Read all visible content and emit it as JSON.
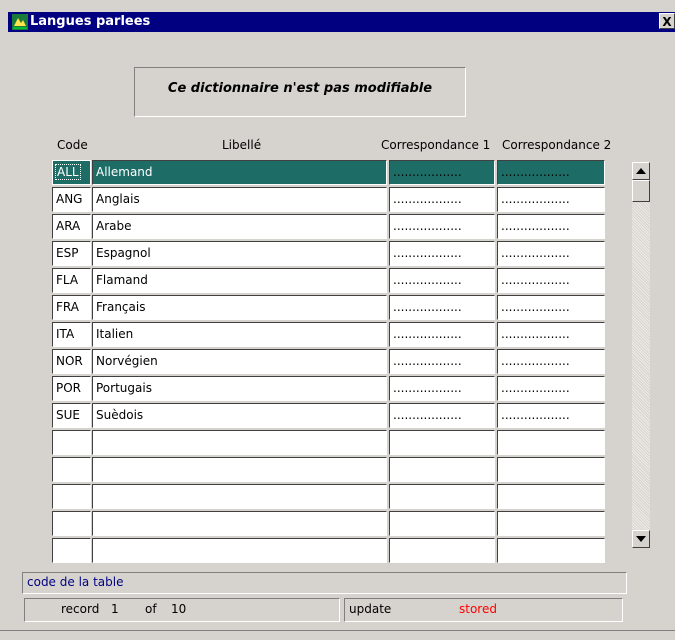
{
  "window": {
    "title": "Langues parlees",
    "close_label": "X"
  },
  "notice": "Ce dictionnaire n'est pas modifiable",
  "columns": {
    "code": "Code",
    "libelle": "Libellé",
    "corr1": "Correspondance 1",
    "corr2": "Correspondance 2"
  },
  "rows": [
    {
      "code": "ALL",
      "libelle": "Allemand",
      "corr1": "..................",
      "corr2": ".................."
    },
    {
      "code": "ANG",
      "libelle": "Anglais",
      "corr1": "..................",
      "corr2": ".................."
    },
    {
      "code": "ARA",
      "libelle": "Arabe",
      "corr1": "..................",
      "corr2": ".................."
    },
    {
      "code": "ESP",
      "libelle": "Espagnol",
      "corr1": "..................",
      "corr2": ".................."
    },
    {
      "code": "FLA",
      "libelle": "Flamand",
      "corr1": "..................",
      "corr2": ".................."
    },
    {
      "code": "FRA",
      "libelle": "Français",
      "corr1": "..................",
      "corr2": ".................."
    },
    {
      "code": "ITA",
      "libelle": "Italien",
      "corr1": "..................",
      "corr2": ".................."
    },
    {
      "code": "NOR",
      "libelle": "Norvégien",
      "corr1": "..................",
      "corr2": ".................."
    },
    {
      "code": "POR",
      "libelle": "Portugais",
      "corr1": "..................",
      "corr2": ".................."
    },
    {
      "code": "SUE",
      "libelle": "Suèdois",
      "corr1": "..................",
      "corr2": ".................."
    },
    {
      "code": "",
      "libelle": "",
      "corr1": "",
      "corr2": ""
    },
    {
      "code": "",
      "libelle": "",
      "corr1": "",
      "corr2": ""
    },
    {
      "code": "",
      "libelle": "",
      "corr1": "",
      "corr2": ""
    },
    {
      "code": "",
      "libelle": "",
      "corr1": "",
      "corr2": ""
    },
    {
      "code": "",
      "libelle": "",
      "corr1": "",
      "corr2": ""
    }
  ],
  "hint": "code de la table",
  "status": {
    "record_label": "record",
    "record_index": "1",
    "of_label": "of",
    "record_total": "10",
    "mode": "update",
    "state": "stored"
  },
  "colors": {
    "title_bar": "#000080",
    "selected_row": "#1d6d66",
    "hint_text": "#000080",
    "state_text": "#ff0000"
  }
}
